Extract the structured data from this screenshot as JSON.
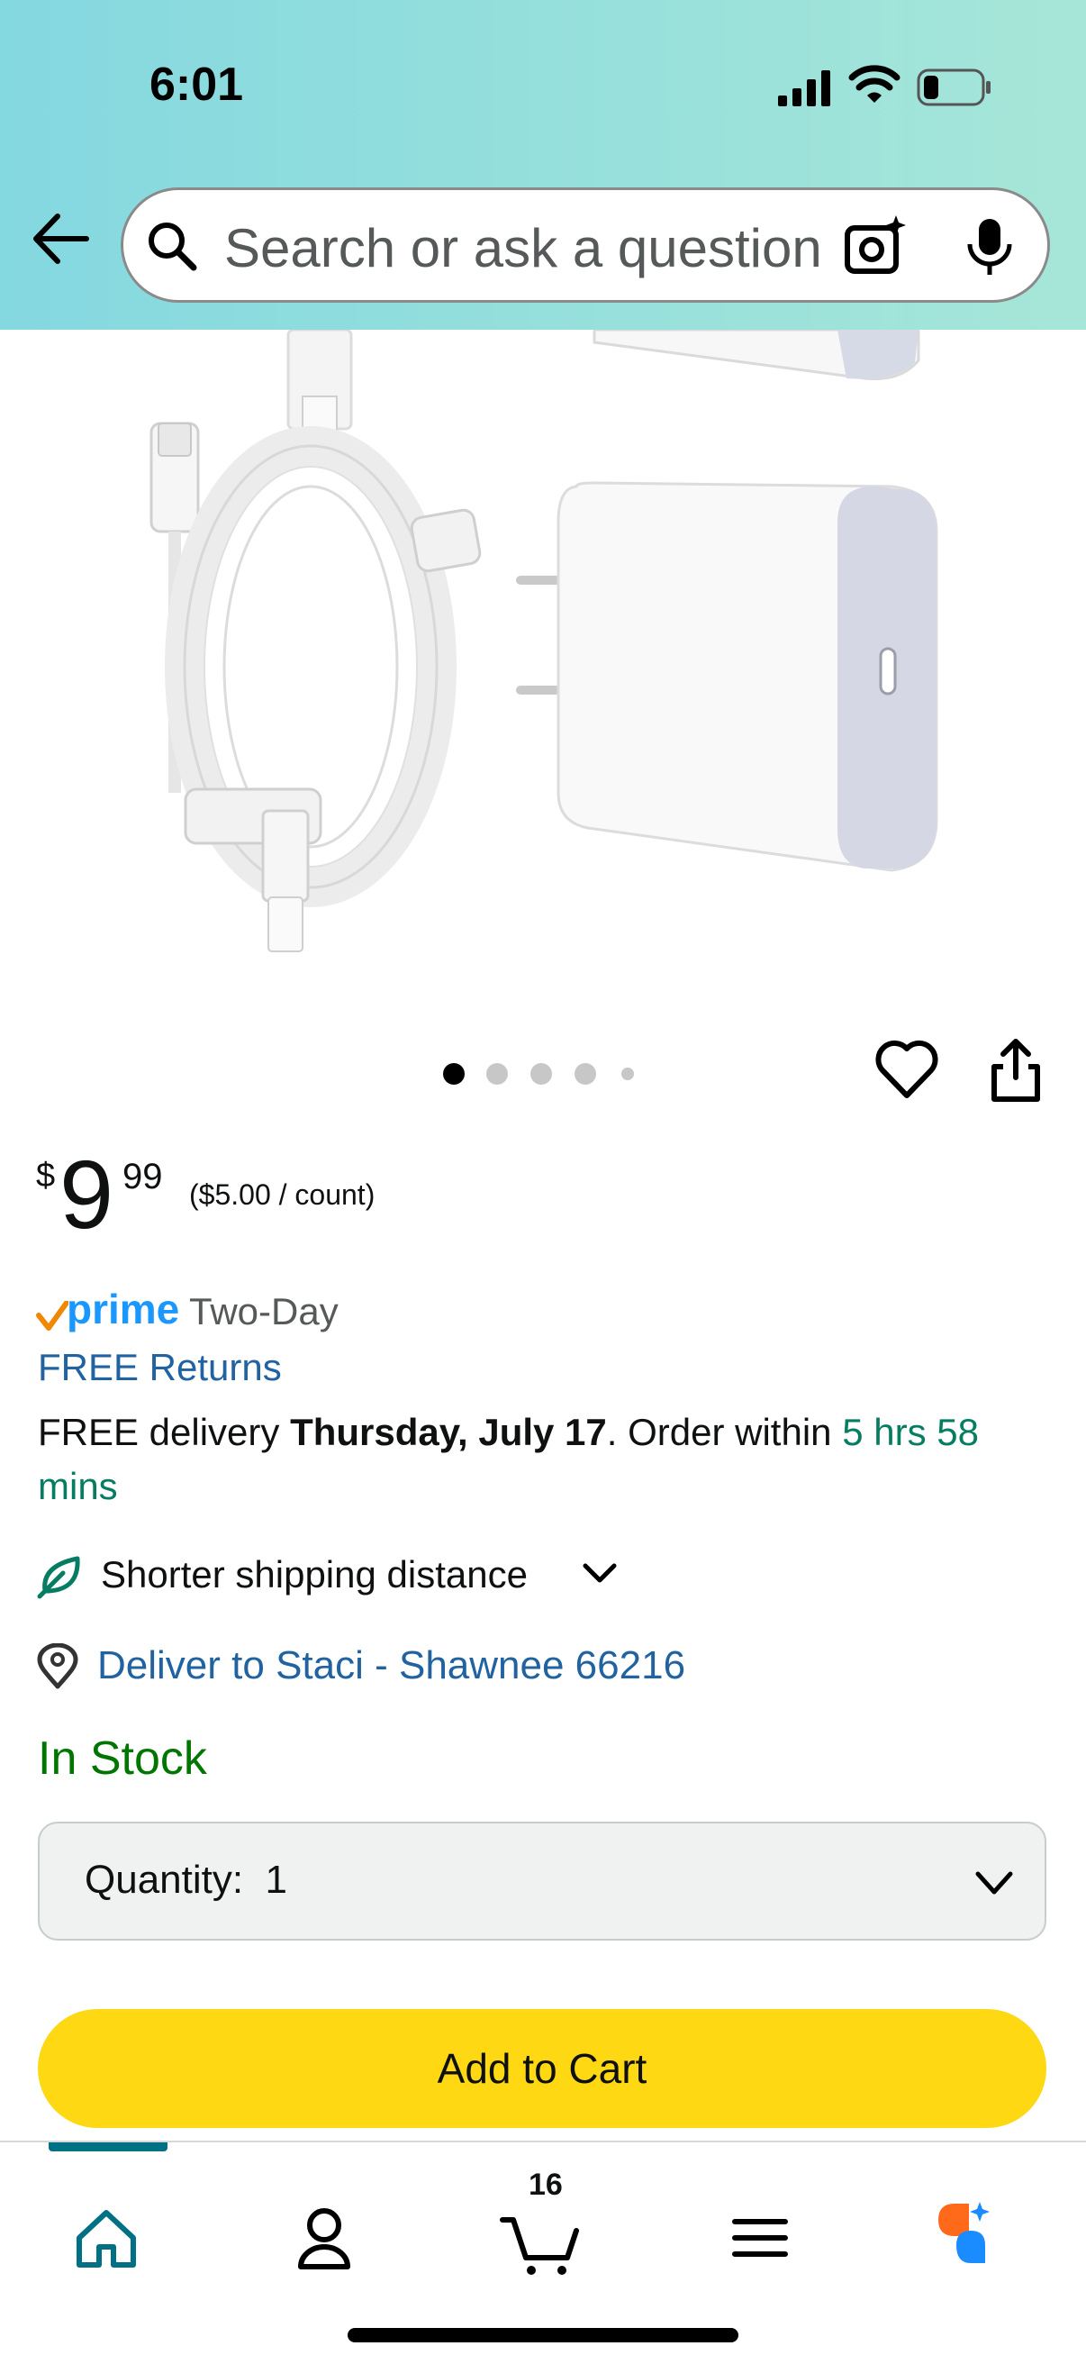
{
  "status_bar": {
    "time": "6:01"
  },
  "header": {
    "search": {
      "placeholder": "Search or ask a question"
    },
    "icons": [
      "back-arrow-icon",
      "search-icon",
      "camera-icon",
      "microphone-icon"
    ]
  },
  "gallery": {
    "image_count": 5,
    "active_index": 0
  },
  "price": {
    "currency": "$",
    "whole": "9",
    "fraction": "99",
    "unit_price": "($5.00 / count)"
  },
  "prime": {
    "badge": "prime",
    "label": "Two-Day"
  },
  "returns": {
    "label": "FREE Returns"
  },
  "delivery": {
    "prefix": "FREE delivery ",
    "date": "Thursday, July 17",
    "middle": ". Order within ",
    "countdown": "5 hrs 58 mins"
  },
  "shipping": {
    "label": "Shorter shipping distance"
  },
  "location": {
    "label": "Deliver to Staci - Shawnee 66216"
  },
  "stock": {
    "label": "In Stock"
  },
  "quantity": {
    "label": "Quantity:",
    "value": "1"
  },
  "actions": {
    "add_to_cart": "Add to Cart"
  },
  "tab_bar": {
    "tabs": [
      "home-icon",
      "account-icon",
      "cart-icon",
      "menu-icon",
      "rufus-icon"
    ],
    "cart_count": "16",
    "active_tab": "home"
  },
  "colors": {
    "header_gradient_start": "#84d8e0",
    "header_gradient_end": "#a6e6d8",
    "link": "#2162a1",
    "countdown_green": "#067d62",
    "in_stock_green": "#007600",
    "prime_blue": "#1a98ff",
    "button_yellow": "#ffd814",
    "active_tab": "#007185"
  }
}
